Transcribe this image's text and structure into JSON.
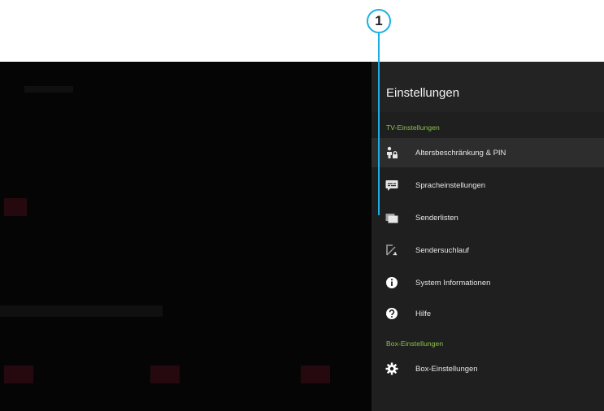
{
  "callout": {
    "number": "1"
  },
  "panel": {
    "title": "Einstellungen",
    "sections": [
      {
        "label": "TV-Einstellungen",
        "items": [
          {
            "label": "Altersbeschränkung & PIN",
            "icon": "parental-lock-icon",
            "selected": true
          },
          {
            "label": "Spracheinstellungen",
            "icon": "subtitles-icon",
            "selected": false
          },
          {
            "label": "Senderlisten",
            "icon": "channel-list-icon",
            "selected": false
          },
          {
            "label": "Sendersuchlauf",
            "icon": "channel-scan-icon",
            "selected": false
          },
          {
            "label": "System Informationen",
            "icon": "info-icon",
            "selected": false
          },
          {
            "label": "Hilfe",
            "icon": "help-icon",
            "selected": false
          }
        ]
      },
      {
        "label": "Box-Einstellungen",
        "items": [
          {
            "label": "Box-Einstellungen",
            "icon": "gear-icon",
            "selected": false
          }
        ]
      }
    ]
  },
  "colors": {
    "accent_green": "#8bc34a",
    "callout_blue": "#1ab1e2",
    "panel_bg": "#1f1f1f",
    "selected_bg": "#2d2d2d"
  }
}
